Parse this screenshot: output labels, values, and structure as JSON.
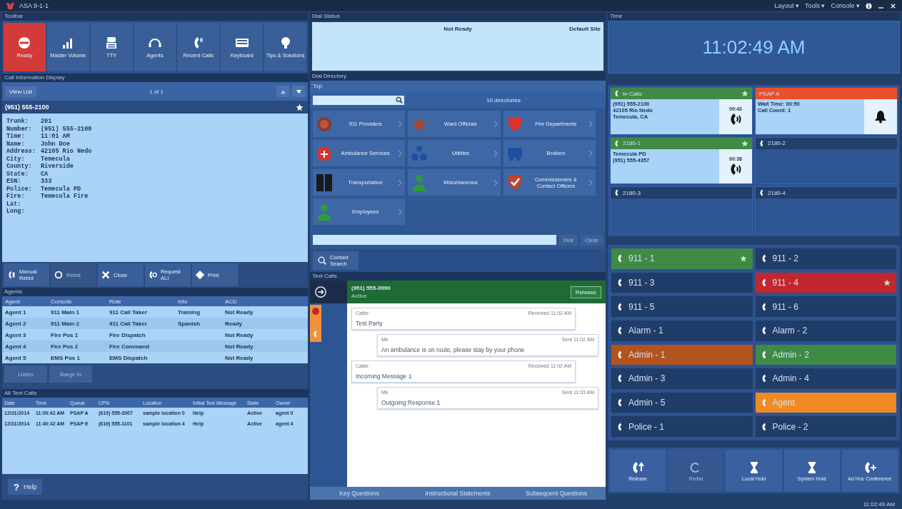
{
  "window": {
    "title": "ASA 9-1-1",
    "menus": [
      "Layout ▾",
      "Tools ▾",
      "Console ▾"
    ]
  },
  "toolbar": {
    "title": "Toolbar",
    "buttons": [
      {
        "label": "Ready",
        "selected": true
      },
      {
        "label": "Master Volume",
        "selected": false
      },
      {
        "label": "TTY",
        "selected": false
      },
      {
        "label": "Agents",
        "selected": false
      },
      {
        "label": "Recent Calls",
        "selected": false
      },
      {
        "label": "Keyboard",
        "selected": false
      },
      {
        "label": "Tips & Solutions",
        "selected": false
      }
    ]
  },
  "call_info": {
    "title": "Call Information Display",
    "view_list": "View List",
    "counter": "1 of 1",
    "phone": "(951) 555-2100",
    "fields": [
      {
        "label": "Trunk:",
        "value": "201"
      },
      {
        "label": "Number:",
        "value": "(951) 555-2100"
      },
      {
        "label": "Time:",
        "value": "11:01 AM"
      },
      {
        "label": "Name:",
        "value": "John Doe"
      },
      {
        "label": "Address:",
        "value": "42105 Rio Nedo"
      },
      {
        "label": "City:",
        "value": "Temecula"
      },
      {
        "label": "County:",
        "value": "Riverside"
      },
      {
        "label": "State:",
        "value": "CA"
      },
      {
        "label": "ESN:",
        "value": "333"
      },
      {
        "label": "Police:",
        "value": "Temecula PD"
      },
      {
        "label": "Fire:",
        "value": "Temecula Fire"
      },
      {
        "label": "Lat:"
      },
      {
        "label": "Long:"
      }
    ],
    "actions": [
      {
        "label": "Manual Rebid",
        "disabled": false
      },
      {
        "label": "Rebid",
        "disabled": true
      },
      {
        "label": "Close",
        "disabled": false
      },
      {
        "label": "Request ALI",
        "disabled": false
      },
      {
        "label": "Print",
        "disabled": false
      }
    ]
  },
  "agents": {
    "title": "Agents",
    "columns": [
      "Agent",
      "Console",
      "Role",
      "Info",
      "ACD"
    ],
    "rows": [
      [
        "Agent 1",
        "911 Main 1",
        "911 Call Taker",
        "Training",
        "Not Ready"
      ],
      [
        "Agent 2",
        "911 Main 2",
        "911 Call Taker",
        "Spanish",
        "Ready"
      ],
      [
        "Agent 3",
        "Fire Pos 1",
        "Fire Dispatch",
        "",
        "Not Ready"
      ],
      [
        "Agent 4",
        "Fire Pos 2",
        "Fire Command",
        "",
        "Not Ready"
      ],
      [
        "Agent 5",
        "EMS Pos 1",
        "EMS Dispatch",
        "",
        "Not Ready"
      ]
    ],
    "buttons": [
      {
        "label": "Listen",
        "disabled": true
      },
      {
        "label": "Barge In",
        "disabled": true
      }
    ]
  },
  "text_calls_table": {
    "title": "All Text Calls",
    "columns": [
      "Date",
      "Time",
      "Queue",
      "CPN",
      "Location",
      "Initial Text Message",
      "State",
      "Owner"
    ],
    "rows": [
      [
        "12/31/2014",
        "11:00:42 AM",
        "PSAP A",
        "(619) 555-3007",
        "sample location 0",
        "Help",
        "Active",
        "agent 0"
      ],
      [
        "12/31/2014",
        "11:40:42 AM",
        "PSAP E",
        "(619) 555-1101",
        "sample location 4",
        "Help",
        "Active",
        "agent 4"
      ]
    ]
  },
  "help_button": {
    "icon": "?",
    "label": "Help"
  },
  "dial_status": {
    "title": "Dial Status",
    "state": "Not Ready",
    "site": "Default Site"
  },
  "dial_directory": {
    "title": "Dial Directory",
    "breadcrumb": "Top",
    "count": "10 directories",
    "entries": [
      "911 Providers",
      "Ward Officials",
      "Fire Departments",
      "Ambulance Services",
      "Utilities",
      "Brokers",
      "Transportation",
      "Miscellaneous",
      "Commissioners & Contact Officers",
      "Employees"
    ],
    "dial_button": "Dial",
    "clear_button": "Clear",
    "contact_search": "Contact Search"
  },
  "text_calls": {
    "title": "Text Calls",
    "caller": "(951) 555-0990",
    "status": "Active",
    "release": "Release",
    "messages": [
      {
        "kind": "incoming",
        "sender": "Caller",
        "time": "Received 11:02 AM",
        "text": "Test Party"
      },
      {
        "kind": "outgoing",
        "sender": "Me",
        "time": "Sent 11:02 AM",
        "text": "An ambulance is on route, please stay by your phone"
      },
      {
        "kind": "incoming",
        "sender": "Caller",
        "time": "Received 11:02 AM",
        "text": "Incoming Message 1"
      },
      {
        "kind": "outgoing",
        "sender": "Me",
        "time": "Sent 11:03 AM",
        "text": "Outgoing Response 1"
      }
    ],
    "tabs": [
      {
        "label": "Key Questions",
        "selected": false
      },
      {
        "label": "Instructional Statements",
        "selected": false
      },
      {
        "label": "Subsequent Questions",
        "selected": false
      }
    ]
  },
  "time": {
    "title": "Time",
    "clock": "11:02:49 AM"
  },
  "line_tiles": [
    {
      "name": "In Calls",
      "kind": "connected",
      "starred": true,
      "details": [
        "(951) 555-2100",
        "42105 Rio Nedo",
        "Temecula, CA"
      ],
      "timer": "00:43"
    },
    {
      "name": "PSAP A",
      "kind": "queued",
      "starred": false,
      "details": [
        "Wait Time: 00:50",
        "Call Count: 1"
      ]
    },
    {
      "name": "2180-1",
      "kind": "connected",
      "starred": true,
      "details": [
        "Temecula PD",
        "(951) 555-4357"
      ],
      "timer": "00:38"
    },
    {
      "name": "2180-2",
      "kind": "idle",
      "starred": false
    },
    {
      "name": "2180-3",
      "kind": "idle",
      "starred": false
    },
    {
      "name": "2180-4",
      "kind": "idle",
      "starred": false
    }
  ],
  "lines": [
    {
      "label": "911 - 1",
      "kind": "connected",
      "starred": true
    },
    {
      "label": "911 - 2",
      "kind": "idle",
      "starred": false
    },
    {
      "label": "911 - 3",
      "kind": "idle",
      "starred": false
    },
    {
      "label": "911 - 4",
      "kind": "alerting",
      "starred": true
    },
    {
      "label": "911 - 5",
      "kind": "idle",
      "starred": false
    },
    {
      "label": "911 - 6",
      "kind": "idle",
      "starred": false
    },
    {
      "label": "Alarm - 1",
      "kind": "idle",
      "starred": false
    },
    {
      "label": "Alarm - 2",
      "kind": "idle",
      "starred": false
    },
    {
      "label": "Admin - 1",
      "kind": "held",
      "starred": false
    },
    {
      "label": "Admin - 2",
      "kind": "connected",
      "starred": false
    },
    {
      "label": "Admin - 3",
      "kind": "idle",
      "starred": false
    },
    {
      "label": "Admin - 4",
      "kind": "idle",
      "starred": false
    },
    {
      "label": "Admin - 5",
      "kind": "idle",
      "starred": false
    },
    {
      "label": "Agent",
      "kind": "ringing",
      "starred": false
    },
    {
      "label": "Police - 1",
      "kind": "idle",
      "starred": false
    },
    {
      "label": "Police - 2",
      "kind": "idle",
      "starred": false
    }
  ],
  "call_actions": [
    {
      "label": "Release",
      "disabled": false
    },
    {
      "label": "Redial",
      "disabled": true
    },
    {
      "label": "Local Hold",
      "disabled": false
    },
    {
      "label": "System Hold",
      "disabled": false
    },
    {
      "label": "Ad Hoc Conference",
      "disabled": false
    }
  ],
  "status_bar": {
    "time": "11:02:49 AM"
  }
}
